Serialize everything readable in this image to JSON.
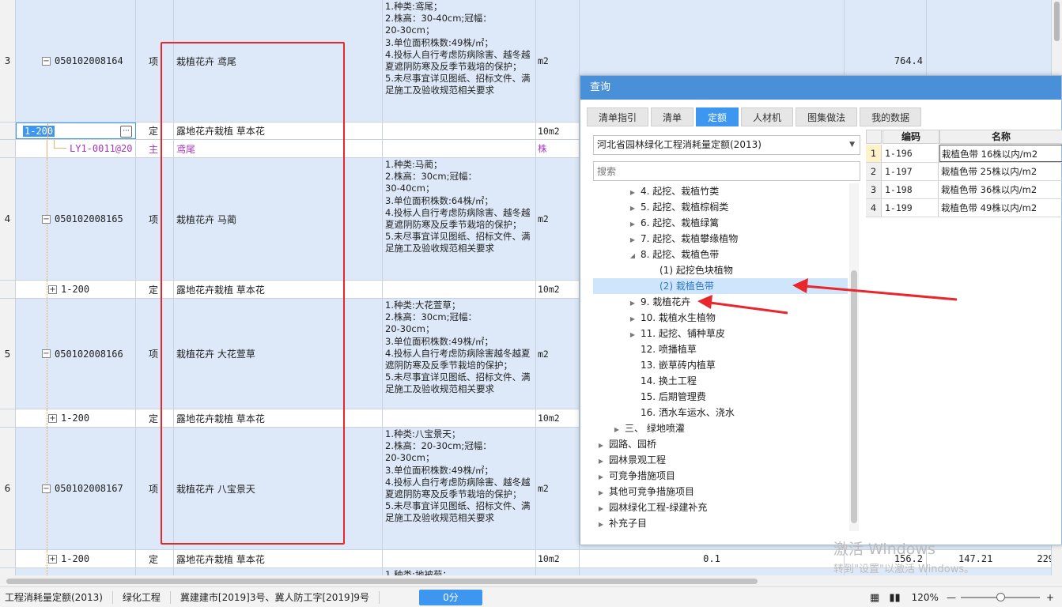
{
  "rows": [
    {
      "num": "3",
      "code": "050102008164",
      "type": "项",
      "name": "栽植花卉 鸢尾",
      "feature": "1.种类:鸢尾；\n2.株高：30-40cm;冠幅：\n20-30cm；\n3.单位面积株数:49株/㎡；\n4.投标人自行考虑防病除害、越冬越夏遮阴防寒及反季节栽培的保护；\n5.未尽事宜详见图纸、招标文件、满足施工及验收规范相关要求",
      "unit": "m2",
      "qty": "",
      "price": "764.4",
      "total": ""
    },
    {
      "num": "",
      "code": "1-200",
      "type": "定",
      "name": "露地花卉栽植 草本花",
      "feature": "",
      "unit": "10m2",
      "qty": "",
      "price": "",
      "total": ""
    },
    {
      "num": "",
      "code": "LY1-0011@20",
      "type": "主",
      "name": "鸢尾",
      "feature": "",
      "unit": "株",
      "qty": "",
      "price": "",
      "total": ""
    },
    {
      "num": "4",
      "code": "050102008165",
      "type": "项",
      "name": "栽植花卉 马蔺",
      "feature": "1.种类:马蔺；\n2.株高：30cm;冠幅：\n30-40cm；\n3.单位面积株数:64株/㎡；\n4.投标人自行考虑防病除害、越冬越夏遮阴防寒及反季节栽培的保护；\n5.未尽事宜详见图纸、招标文件、满足施工及验收规范相关要求",
      "unit": "m2",
      "qty": "",
      "price": "",
      "total": ""
    },
    {
      "num": "",
      "code": "1-200",
      "type": "定",
      "name": "露地花卉栽植 草本花",
      "feature": "",
      "unit": "10m2",
      "qty": "",
      "price": "",
      "total": ""
    },
    {
      "num": "5",
      "code": "050102008166",
      "type": "项",
      "name": "栽植花卉 大花萱草",
      "feature": "1.种类:大花萱草；\n2.株高：30cm;冠幅：\n20-30cm；\n3.单位面积株数:49株/㎡；\n4.投标人自行考虑防病除害越冬越夏遮阴防寒及反季节栽培的保护；\n5.未尽事宜详见图纸、招标文件、满足施工及验收规范相关要求",
      "unit": "m2",
      "qty": "",
      "price": "",
      "total": ""
    },
    {
      "num": "",
      "code": "1-200",
      "type": "定",
      "name": "露地花卉栽植 草本花",
      "feature": "",
      "unit": "10m2",
      "qty": "",
      "price": "",
      "total": ""
    },
    {
      "num": "6",
      "code": "050102008167",
      "type": "项",
      "name": "栽植花卉 八宝景天",
      "feature": "1.种类:八宝景天；\n2.株高：20-30cm;冠幅：\n20-30cm；\n3.单位面积株数:49株/㎡；\n4.投标人自行考虑防病除害、越冬越夏遮阴防寒及反季节栽培的保护；\n5.未尽事宜详见图纸、招标文件、满足施工及验收规范相关要求",
      "unit": "m2",
      "qty": "",
      "price": "",
      "total": ""
    },
    {
      "num": "",
      "code": "1-200",
      "type": "定",
      "name": "露地花卉栽植 草本花",
      "feature": "",
      "unit": "10m2",
      "qty": "0.1",
      "price": "156.2",
      "total": "147.21"
    },
    {
      "num": "",
      "code": "",
      "type": "",
      "name": "",
      "feature": "1.种类:地被菊；",
      "unit": "",
      "qty": "",
      "price": "",
      "total": ""
    }
  ],
  "extra_total": "229",
  "dialog": {
    "title": "查询",
    "tabs": [
      "清单指引",
      "清单",
      "定额",
      "人材机",
      "图集做法",
      "我的数据"
    ],
    "active_tab": "定额",
    "library": "河北省园林绿化工程消耗量定额(2013)",
    "search_placeholder": "搜索",
    "tree": [
      {
        "label": "4. 起挖、栽植竹类",
        "indent": 3,
        "arrow": "right"
      },
      {
        "label": "5. 起挖、栽植棕榈类",
        "indent": 3,
        "arrow": "right"
      },
      {
        "label": "6. 起挖、栽植绿篱",
        "indent": 3,
        "arrow": "right"
      },
      {
        "label": "7. 起挖、栽植攀缘植物",
        "indent": 3,
        "arrow": "right"
      },
      {
        "label": "8. 起挖、栽植色带",
        "indent": 3,
        "arrow": "down"
      },
      {
        "label": "(1) 起挖色块植物",
        "indent": 4,
        "arrow": ""
      },
      {
        "label": "(2) 栽植色带",
        "indent": 4,
        "arrow": "",
        "selected": true
      },
      {
        "label": "9. 栽植花卉",
        "indent": 3,
        "arrow": "right"
      },
      {
        "label": "10. 栽植水生植物",
        "indent": 3,
        "arrow": "right"
      },
      {
        "label": "11. 起挖、铺种草皮",
        "indent": 3,
        "arrow": "right"
      },
      {
        "label": "12. 喷播植草",
        "indent": 3,
        "arrow": ""
      },
      {
        "label": "13. 嵌草砖内植草",
        "indent": 3,
        "arrow": ""
      },
      {
        "label": "14. 换土工程",
        "indent": 3,
        "arrow": ""
      },
      {
        "label": "15. 后期管理费",
        "indent": 3,
        "arrow": ""
      },
      {
        "label": "16. 洒水车运水、浇水",
        "indent": 3,
        "arrow": ""
      },
      {
        "label": "三、 绿地喷灌",
        "indent": 2,
        "arrow": "right"
      },
      {
        "label": "园路、园桥",
        "indent": 1,
        "arrow": "right"
      },
      {
        "label": "园林景观工程",
        "indent": 1,
        "arrow": "right"
      },
      {
        "label": "可竞争措施项目",
        "indent": 1,
        "arrow": "right"
      },
      {
        "label": "其他可竞争措施项目",
        "indent": 1,
        "arrow": "right"
      },
      {
        "label": "园林绿化工程-绿建补充",
        "indent": 1,
        "arrow": "right"
      },
      {
        "label": "补充子目",
        "indent": 1,
        "arrow": "right"
      }
    ],
    "result_headers": {
      "code": "编码",
      "name": "名称"
    },
    "results": [
      {
        "n": "1",
        "code": "1-196",
        "name": "栽植色带 16株以内/m2"
      },
      {
        "n": "2",
        "code": "1-197",
        "name": "栽植色带 25株以内/m2"
      },
      {
        "n": "3",
        "code": "1-198",
        "name": "栽植色带 36株以内/m2"
      },
      {
        "n": "4",
        "code": "1-199",
        "name": "栽植色带 49株以内/m2"
      }
    ]
  },
  "status": {
    "items": [
      "工程消耗量定额(2013)",
      "绿化工程",
      "冀建建市[2019]3号、冀人防工字[2019]9号"
    ],
    "score": "0分",
    "zoom": "120%"
  },
  "watermark": {
    "line1": "激活 Windows",
    "line2": "转到\"设置\"以激活 Windows。"
  },
  "colors": {
    "accent": "#3d96f0",
    "row_blue": "#dde9f8",
    "annotation_red": "#e8262b",
    "link_purple": "#a03ab8"
  }
}
